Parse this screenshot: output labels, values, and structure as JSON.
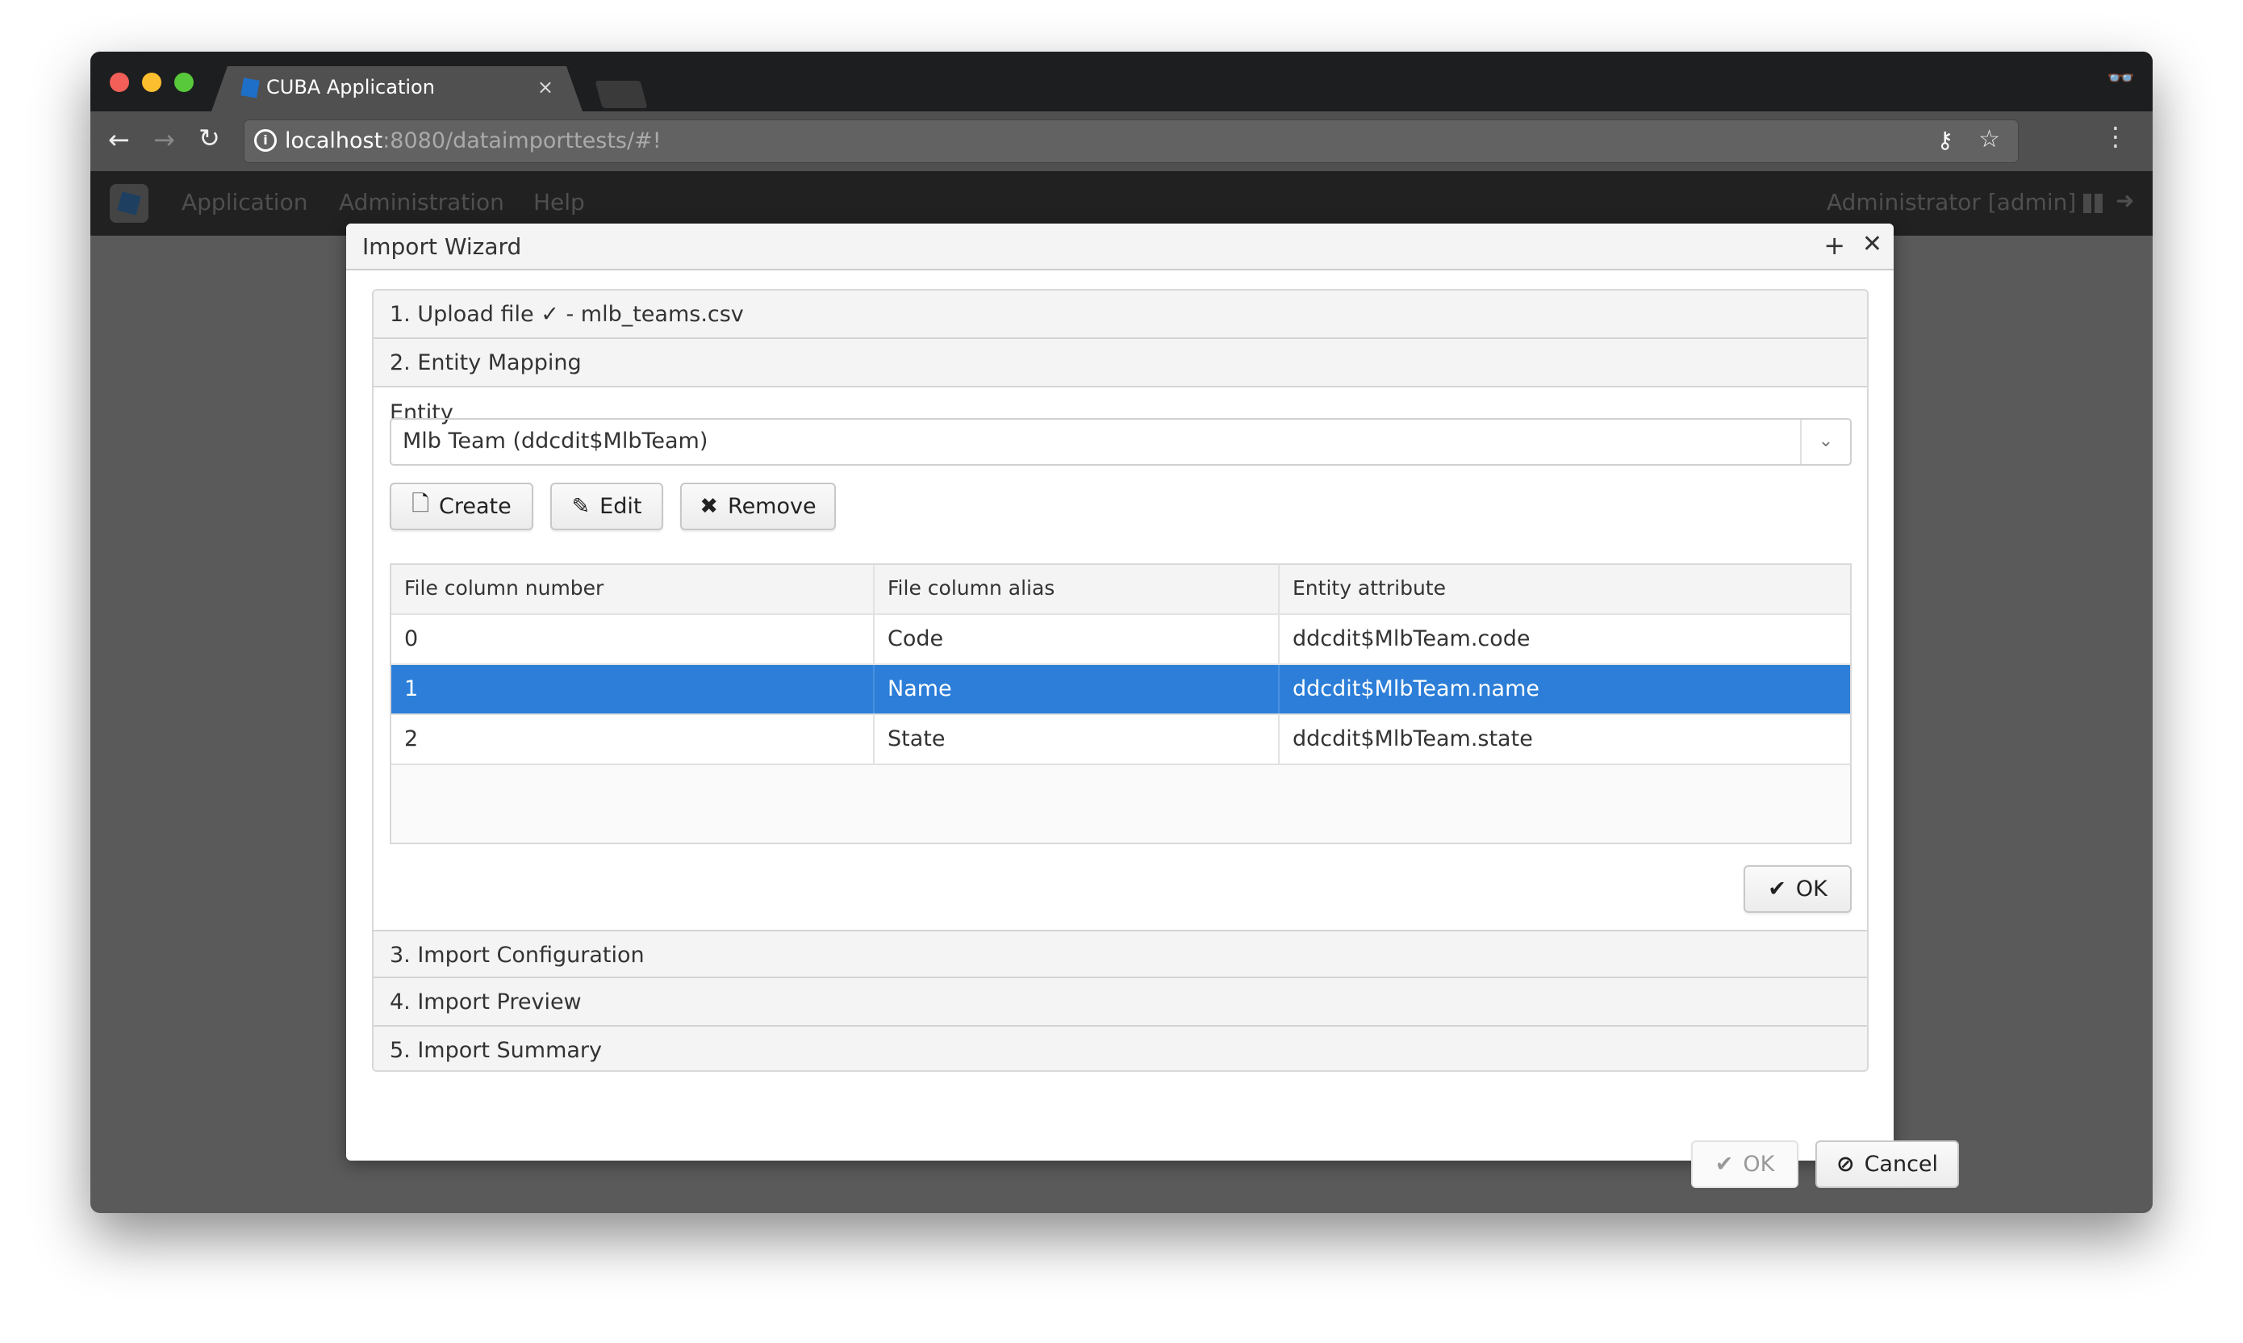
{
  "browser": {
    "tab_title": "CUBA Application",
    "url_host": "localhost",
    "url_path": ":8080/dataimporttests/#!"
  },
  "app_menu": {
    "items": [
      "Application",
      "Administration",
      "Help"
    ],
    "user": "Administrator [admin]"
  },
  "dialog": {
    "title": "Import Wizard",
    "steps": [
      "1. Upload file ✓ - mlb_teams.csv",
      "2. Entity Mapping",
      "3. Import Configuration",
      "4. Import Preview",
      "5. Import Summary"
    ],
    "entity_label": "Entity",
    "entity_value": "Mlb Team (ddcdit$MlbTeam)",
    "buttons": {
      "create": "Create",
      "edit": "Edit",
      "remove": "Remove",
      "ok": "OK",
      "footer_ok": "OK",
      "cancel": "Cancel"
    },
    "table": {
      "columns": [
        "File column number",
        "File column alias",
        "Entity attribute"
      ],
      "rows": [
        [
          "0",
          "Code",
          "ddcdit$MlbTeam.code"
        ],
        [
          "1",
          "Name",
          "ddcdit$MlbTeam.name"
        ],
        [
          "2",
          "State",
          "ddcdit$MlbTeam.state"
        ]
      ],
      "selected_row": 1
    }
  },
  "colors": {
    "selection": "#2c7ed8"
  }
}
